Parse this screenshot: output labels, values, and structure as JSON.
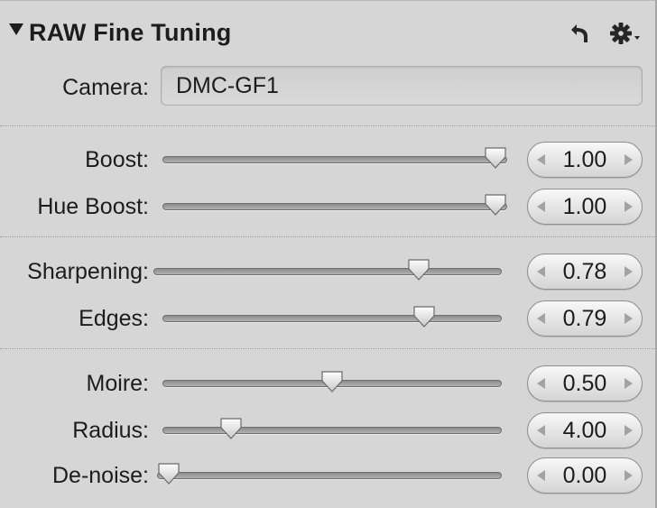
{
  "panel": {
    "title": "RAW Fine Tuning",
    "reset_icon": "reset-arrow-icon",
    "gear_icon": "gear-menu-icon"
  },
  "camera": {
    "label": "Camera:",
    "value": "DMC-GF1"
  },
  "sliders": [
    {
      "label": "Boost:",
      "value": "1.00",
      "min": 0,
      "max": 1,
      "level": 1.0
    },
    {
      "label": "Hue Boost:",
      "value": "1.00",
      "min": 0,
      "max": 1,
      "level": 1.0
    },
    {
      "label": "Sharpening:",
      "value": "0.78",
      "min": 0,
      "max": 1,
      "level": 0.78
    },
    {
      "label": "Edges:",
      "value": "0.79",
      "min": 0,
      "max": 1,
      "level": 0.79
    },
    {
      "label": "Moire:",
      "value": "0.50",
      "min": 0,
      "max": 1,
      "level": 0.5
    },
    {
      "label": "Radius:",
      "value": "4.00",
      "min": 1,
      "max": 25,
      "level": 0.18
    },
    {
      "label": "De-noise:",
      "value": "0.00",
      "min": 0,
      "max": 1,
      "level": 0.0
    }
  ]
}
